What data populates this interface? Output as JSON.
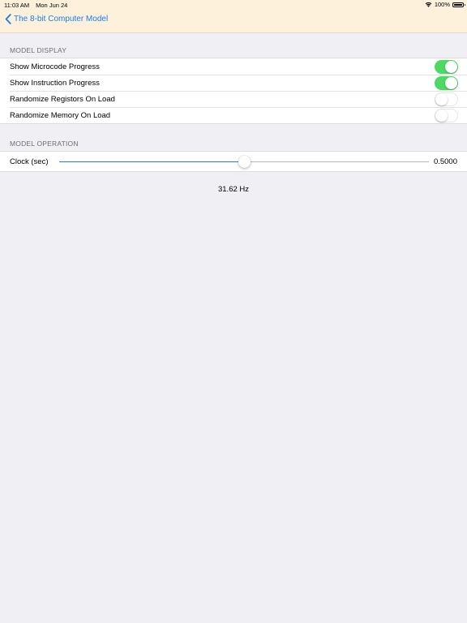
{
  "status_bar": {
    "time": "11:03 AM",
    "date": "Mon Jun 24",
    "battery": "100%",
    "icons": [
      "wifi-icon",
      "battery-icon"
    ]
  },
  "nav": {
    "back_label": "The 8-bit Computer Model",
    "back_icon": "chevron-left-icon"
  },
  "model_display": {
    "header": "MODEL DISPLAY",
    "rows": [
      {
        "label": "Show Microcode Progress",
        "on": true
      },
      {
        "label": "Show Instruction Progress",
        "on": true
      },
      {
        "label": "Randomize Registors On Load",
        "on": false
      },
      {
        "label": "Randomize Memory On Load",
        "on": false
      }
    ]
  },
  "model_operation": {
    "header": "MODEL OPERATION",
    "clock": {
      "label": "Clock (sec)",
      "value_text": "0.5000",
      "position_fraction": 0.5
    }
  },
  "frequency": "31.62 Hz",
  "colors": {
    "accent": "#1a7cf5",
    "toggle_on": "#4cd964",
    "nav_background": "#fdf1dc",
    "page_background": "#efeff4"
  }
}
